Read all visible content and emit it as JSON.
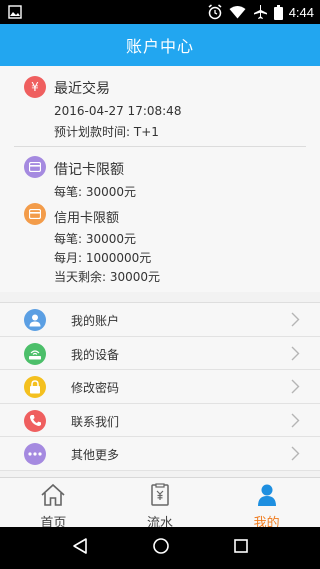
{
  "status_bar": {
    "time": "4:44"
  },
  "header": {
    "title": "账户中心"
  },
  "recent_transaction": {
    "icon_symbol": "¥",
    "title": "最近交易",
    "datetime": "2016-04-27 17:08:48",
    "settlement": "预计划款时间:  T+1"
  },
  "debit_limit": {
    "title": "借记卡限额",
    "per_transaction": "每笔:  30000元"
  },
  "credit_limit": {
    "title": "信用卡限额",
    "per_transaction": "每笔:  30000元",
    "per_month": "每月:  1000000元",
    "remaining_today": "当天剩余:  30000元"
  },
  "menu": {
    "items": [
      {
        "label": "我的账户",
        "icon": "user-icon",
        "color": "#5b9fe3"
      },
      {
        "label": "我的设备",
        "icon": "device-icon",
        "color": "#4cbf6a"
      },
      {
        "label": "修改密码",
        "icon": "lock-icon",
        "color": "#f4c01f"
      },
      {
        "label": "联系我们",
        "icon": "phone-icon",
        "color": "#ef5f5f"
      },
      {
        "label": "其他更多",
        "icon": "more-icon",
        "color": "#a58ae0"
      }
    ]
  },
  "tabbar": {
    "tabs": [
      {
        "label": "首页",
        "icon": "home-icon"
      },
      {
        "label": "流水",
        "icon": "receipt-icon"
      },
      {
        "label": "我的",
        "icon": "profile-icon",
        "active": true
      }
    ]
  },
  "colors": {
    "header_bg": "#22a6f0",
    "accent_active": "#ef7c1f",
    "recent_icon": "#ef5f5f",
    "debit_icon": "#a58ae0",
    "credit_icon": "#f39c4a"
  }
}
